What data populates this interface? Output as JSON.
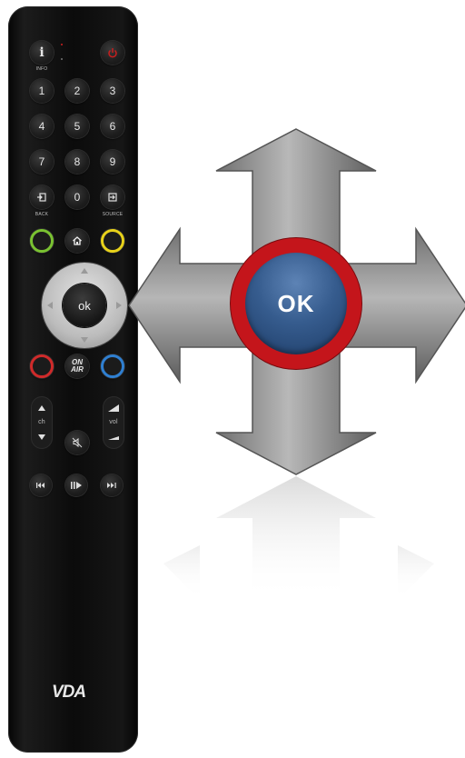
{
  "remote": {
    "info_label": "INFO",
    "info_button": "i",
    "digits": [
      "1",
      "2",
      "3",
      "4",
      "5",
      "6",
      "7",
      "8",
      "9"
    ],
    "zero": "0",
    "back_label": "BACK",
    "source_label": "SOURCE",
    "ok_label": "ok",
    "on_air_line1": "ON",
    "on_air_line2": "AIR",
    "ch_label": "ch",
    "vol_label": "vol",
    "brand": "VDA",
    "colors": {
      "green": "#7ac231",
      "yellow": "#e8d21a",
      "red": "#d02a2a",
      "blue": "#2f7fd1",
      "power": "#c81e1e"
    }
  },
  "big_ok": {
    "label": "OK",
    "ring_color": "#c4151b",
    "fill_color": "#365c8e"
  },
  "icons": [
    "power-icon",
    "input-icon",
    "source-icon",
    "home-icon",
    "mute-icon",
    "rewind-icon",
    "play-pause-icon",
    "fast-forward-icon",
    "four-way-arrow-icon"
  ]
}
